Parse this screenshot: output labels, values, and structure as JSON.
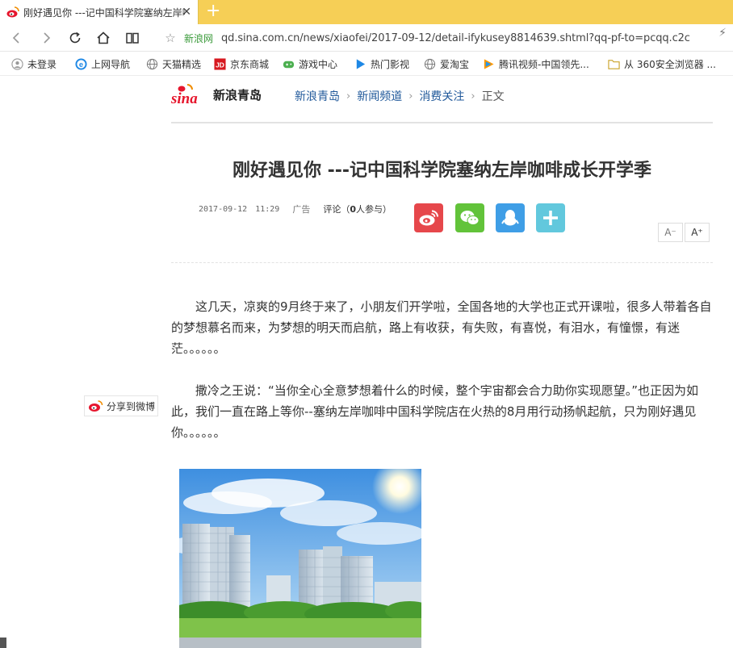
{
  "browser": {
    "tab_title": "刚好遇见你 ---记中国科学院塞纳左岸咖",
    "site_label": "新浪网",
    "url": "qd.sina.com.cn/news/xiaofei/2017-09-12/detail-ifykusey8814639.shtml?qq-pf-to=pcqq.c2c"
  },
  "bookmarks": [
    {
      "label": "未登录",
      "icon": "user-icon"
    },
    {
      "label": "上网导航",
      "icon": "ie-icon"
    },
    {
      "label": "天猫精选",
      "icon": "globe-icon"
    },
    {
      "label": "京东商城",
      "icon": "jd-icon"
    },
    {
      "label": "游戏中心",
      "icon": "gamepad-icon"
    },
    {
      "label": "热门影视",
      "icon": "play-icon"
    },
    {
      "label": "爱淘宝",
      "icon": "globe-icon"
    },
    {
      "label": "腾讯视频-中国领先...",
      "icon": "tencent-video-icon"
    },
    {
      "label": "从 360安全浏览器 ...",
      "icon": "folder-icon"
    }
  ],
  "page": {
    "logo_brand": "sina",
    "logo_text": "新浪青岛",
    "breadcrumb": [
      "新浪青岛",
      "新闻频道",
      "消费关注",
      "正文"
    ],
    "headline": "刚好遇见你 ---记中国科学院塞纳左岸咖啡成长开学季",
    "meta": {
      "date": "2017-09-12",
      "time": "11:29",
      "ad": "广告",
      "comment_prefix": "评论（",
      "comment_count": "0",
      "comment_suffix": "人参与）"
    },
    "share_buttons": [
      {
        "name": "weibo",
        "color": "#e6474b"
      },
      {
        "name": "wechat",
        "color": "#62c33a"
      },
      {
        "name": "qq",
        "color": "#3f9ee6"
      },
      {
        "name": "more",
        "color": "#62c8dd"
      }
    ],
    "font_smaller": "A⁻",
    "font_larger": "A⁺",
    "paragraphs": [
      "这几天，凉爽的9月终于来了，小朋友们开学啦，全国各地的大学也正式开课啦，很多人带着各自的梦想慕名而来，为梦想的明天而启航，路上有收获，有失败，有喜悦，有泪水，有憧憬，有迷茫。。。。。。",
      "撒冷之王说：“当你全心全意梦想着什么的时候，整个宇宙都会合力助你实现愿望。”也正因为如此，我们一直在路上等你--塞纳左岸咖啡中国科学院店在火热的8月用行动扬帆起航，只为刚好遇见你。。。。。。"
    ],
    "side_share": "分享到微博"
  }
}
